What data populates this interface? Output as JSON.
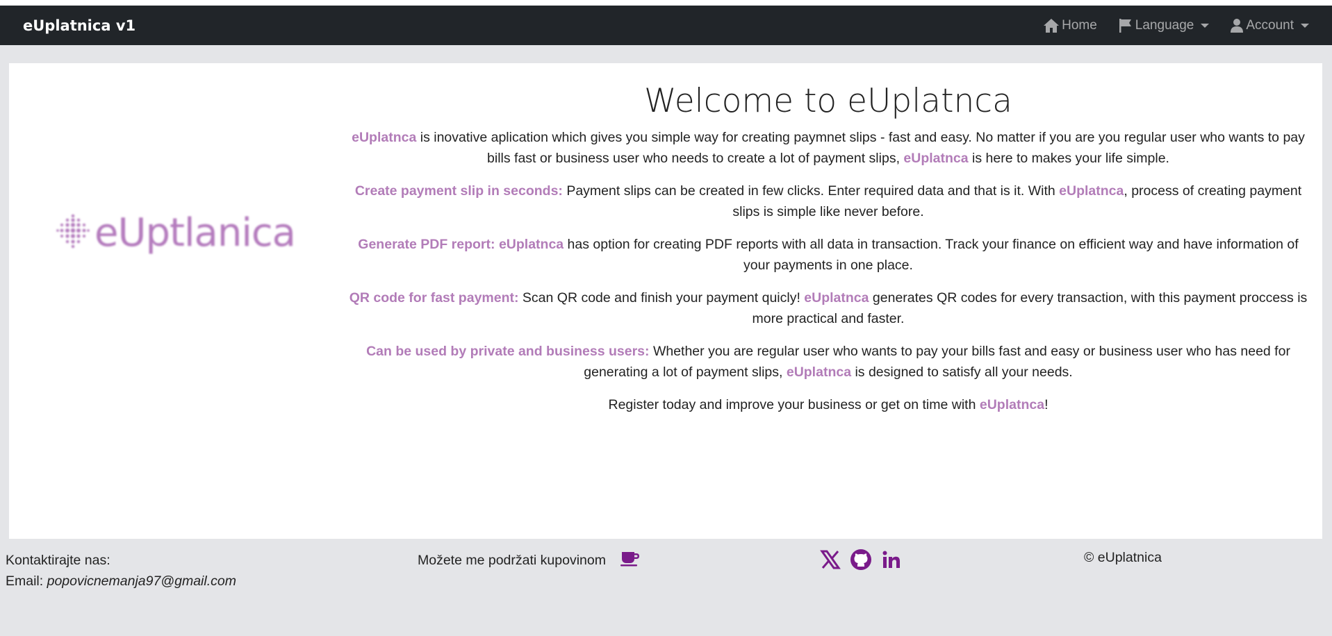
{
  "navbar": {
    "brand": "eUplatnica v1",
    "home_label": "Home",
    "language_label": "Language",
    "account_label": "Account"
  },
  "logo": {
    "text": "eUptlanica"
  },
  "main": {
    "title": "Welcome to eUplatnca",
    "intro": {
      "brand1": "eUplatnca",
      "text1": " is inovative aplication which gives you simple way for creating paymnet slips - fast and easy. No matter if you are you regular user who wants to pay bills fast or business user who needs to create a lot of payment slips, ",
      "brand2": "eUplatnca",
      "text2": " is here to makes your life simple."
    },
    "feature1": {
      "heading": "Create payment slip in seconds:",
      "text1": " Payment slips can be created in few clicks. Enter required data and that is it. With ",
      "brand": "eUplatnca",
      "text2": ", process of creating payment slips is simple like never before."
    },
    "feature2": {
      "heading": "Generate PDF report:",
      "brand": "eUplatnca",
      "text1": " has option for creating PDF reports with all data in transaction. Track your finance on efficient way and have information of your payments in one place."
    },
    "feature3": {
      "heading": "QR code for fast payment:",
      "text1": " Scan QR code and finish your payment quicly! ",
      "brand": "eUplatnca",
      "text2": " generates QR codes for every transaction, with this payment proccess is more practical and faster."
    },
    "feature4": {
      "heading": "Can be used by private and business users:",
      "text1": " Whether you are regular user who wants to pay your bills fast and easy or business user who has need for generating a lot of payment slips, ",
      "brand": "eUplatnca",
      "text2": " is designed to satisfy all your needs."
    },
    "outro": {
      "text1": "Register today and improve your business or get on time with ",
      "brand": "eUplatnca",
      "text2": "!"
    }
  },
  "footer": {
    "contact_label": "Kontaktirajte nas:",
    "email_label": "Email:",
    "email": "popovicnemanja97@gmail.com",
    "support_text": "Možete me podržati kupovinom",
    "copyright": "© eUplatnica"
  },
  "colors": {
    "navbar_bg": "#212529",
    "accent": "#b27cb8",
    "icon_purple": "#7a1b8a",
    "page_bg": "#e4e5e8"
  },
  "icons": [
    "home-icon",
    "flag-icon",
    "user-icon",
    "coffee-icon",
    "x-twitter-icon",
    "github-icon",
    "linkedin-icon"
  ]
}
